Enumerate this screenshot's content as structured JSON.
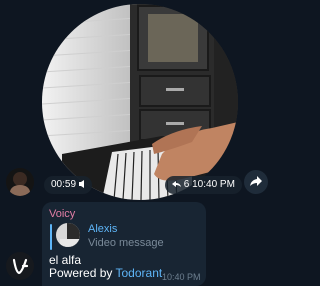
{
  "video_message": {
    "duration": "00:59",
    "forward_count": "6",
    "time": "10:40 PM"
  },
  "text_message": {
    "sender": "Voicy",
    "reply": {
      "name": "Alexis",
      "label": "Video message"
    },
    "line1": "el alfa",
    "powered_prefix": "Powered by ",
    "powered_link": "Todorant",
    "time": "10:40 PM"
  },
  "icons": {
    "audio": "speaker-icon",
    "forwarded": "forwarded-arrow-icon",
    "forward_button": "share-arrow-icon"
  },
  "colors": {
    "background": "#0e1621",
    "bubble": "#182533",
    "sender": "#e27ea6",
    "link": "#5eb5f7"
  }
}
